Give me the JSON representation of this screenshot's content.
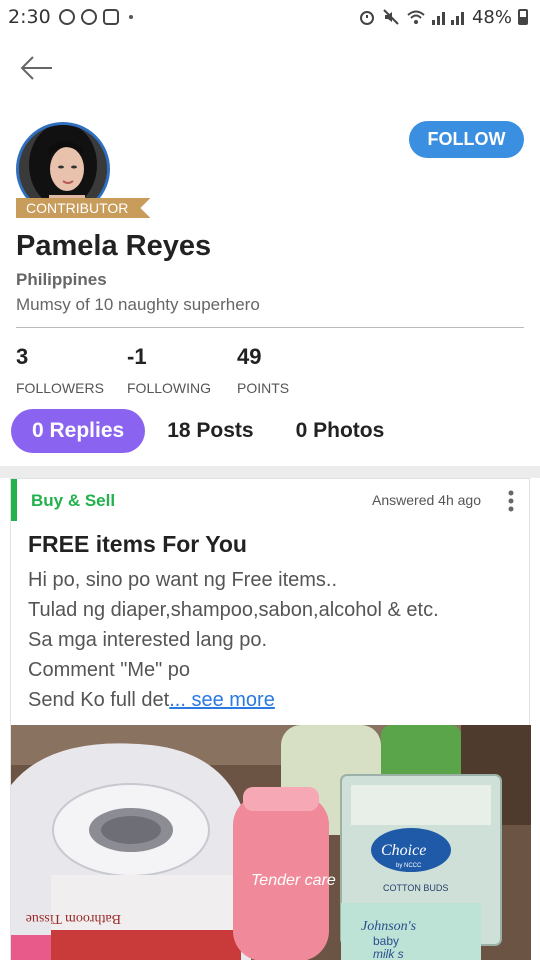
{
  "status_bar": {
    "time": "2:30",
    "battery": "48%"
  },
  "profile": {
    "badge": "CONTRIBUTOR",
    "follow_label": "FOLLOW",
    "name": "Pamela Reyes",
    "location": "Philippines",
    "bio": "Mumsy of 10 naughty superhero"
  },
  "stats": [
    {
      "value": "3",
      "label": "FOLLOWERS"
    },
    {
      "value": "-1",
      "label": "FOLLOWING"
    },
    {
      "value": "49",
      "label": "POINTS"
    }
  ],
  "tabs": [
    {
      "label": "0 Replies",
      "active": true
    },
    {
      "label": "18 Posts",
      "active": false
    },
    {
      "label": "0 Photos",
      "active": false
    }
  ],
  "post": {
    "category": "Buy & Sell",
    "meta": "Answered 4h ago",
    "title": "FREE items For You",
    "lines": [
      "Hi po, sino po want ng Free items..",
      "Tulad ng diaper,shampoo,sabon,alcohol & etc.",
      "Sa mga interested lang po.",
      "Comment \"Me\" po",
      "Send Ko full det"
    ],
    "see_more": "... see more"
  },
  "photo_labels": {
    "tissue": "Bathroom Tissue",
    "tender_care": "Tender care",
    "choice": "Choice",
    "choice_sub": "by NCCC",
    "cotton_buds": "COTTON BUDS",
    "johnsons": "Johnson's",
    "baby": "baby",
    "milk": "milk s"
  },
  "colors": {
    "follow": "#3b8fe0",
    "active_tab": "#8a64f0",
    "category": "#22b14c",
    "badge": "#c89c5a",
    "link": "#2a7ae2"
  }
}
